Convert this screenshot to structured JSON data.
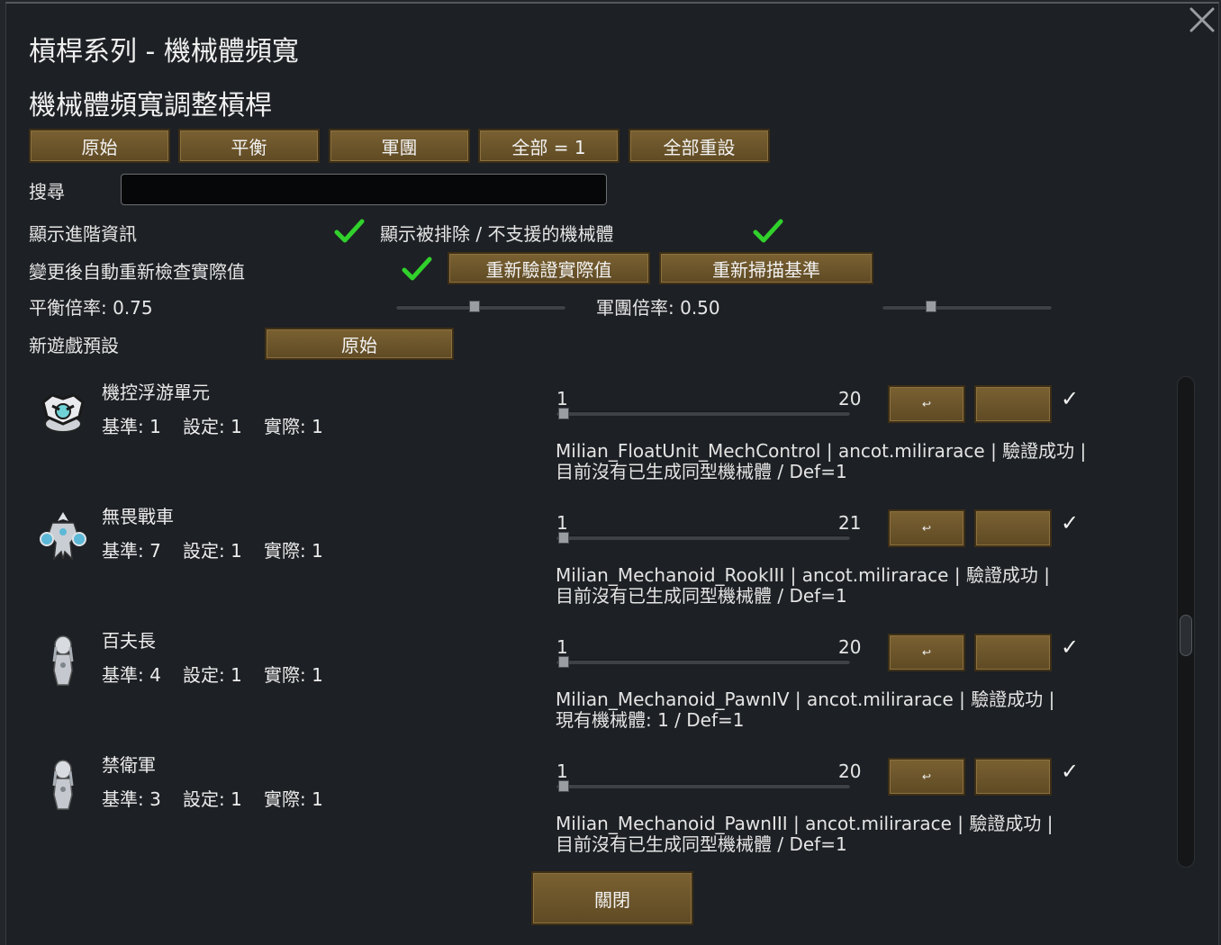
{
  "window": {
    "title": "槓桿系列 - 機械體頻寬",
    "subtitle": "機械體頻寬調整槓桿"
  },
  "presets": [
    "原始",
    "平衡",
    "軍團",
    "全部 = 1",
    "全部重設"
  ],
  "search": {
    "label": "搜尋",
    "value": ""
  },
  "options": {
    "advanced_info": "顯示進階資訊",
    "show_excluded": "顯示被排除 / 不支援的機械體",
    "auto_recheck": "變更後自動重新檢查實際值",
    "revalidate_button": "重新驗證實際值",
    "rescan_button": "重新掃描基準",
    "balance_label": "平衡倍率: 0.75",
    "balance_value": 0.75,
    "legion_label": "軍團倍率: 0.50",
    "legion_value": 0.5,
    "new_game_label": "新遊戲預設",
    "new_game_button": "原始"
  },
  "colors": {
    "check": "#31d12c",
    "button": "#6e5630",
    "background": "#1d2024"
  },
  "mechs": [
    {
      "name": "機控浮游單元",
      "icon": "float-unit-icon",
      "base": "基準: 1",
      "set": "設定: 1",
      "actual": "實際: 1",
      "slider_min": "1",
      "slider_max": "20",
      "slider_value": 1,
      "desc_line1": "Milian_FloatUnit_MechControl  |  ancot.milirarace  |  驗證成功  |",
      "desc_line2": "目前沒有已生成同型機械體 / Def=1",
      "reset_glyph": "↩",
      "tick": "✓"
    },
    {
      "name": "無畏戰車",
      "icon": "rook-mech-icon",
      "base": "基準: 7",
      "set": "設定: 1",
      "actual": "實際: 1",
      "slider_min": "1",
      "slider_max": "21",
      "slider_value": 1,
      "desc_line1": "Milian_Mechanoid_RookIII  |  ancot.milirarace  |  驗證成功  |",
      "desc_line2": "目前沒有已生成同型機械體 / Def=1",
      "reset_glyph": "↩",
      "tick": "✓"
    },
    {
      "name": "百夫長",
      "icon": "pawn-mech-icon",
      "base": "基準: 4",
      "set": "設定: 1",
      "actual": "實際: 1",
      "slider_min": "1",
      "slider_max": "20",
      "slider_value": 1,
      "desc_line1": "Milian_Mechanoid_PawnIV  |  ancot.milirarace  |  驗證成功  |",
      "desc_line2": "現有機械體: 1 / Def=1",
      "reset_glyph": "↩",
      "tick": "✓"
    },
    {
      "name": "禁衛軍",
      "icon": "pawn-mech-icon",
      "base": "基準: 3",
      "set": "設定: 1",
      "actual": "實際: 1",
      "slider_min": "1",
      "slider_max": "20",
      "slider_value": 1,
      "desc_line1": "Milian_Mechanoid_PawnIII  |  ancot.milirarace  |  驗證成功  |",
      "desc_line2": "目前沒有已生成同型機械體 / Def=1",
      "reset_glyph": "↩",
      "tick": "✓"
    }
  ],
  "close_button": "關閉"
}
